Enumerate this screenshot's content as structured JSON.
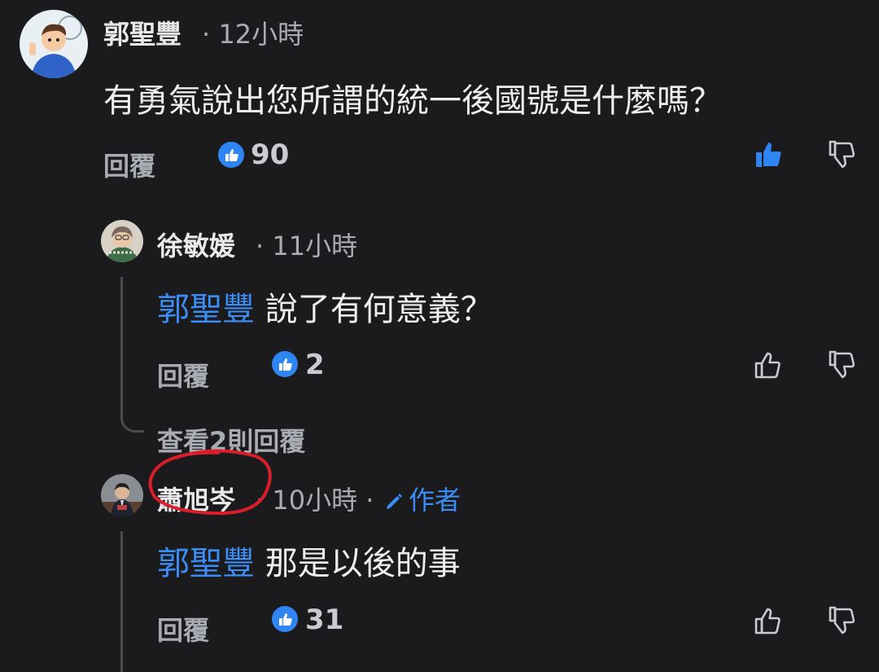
{
  "comments": [
    {
      "author": "郭聖豐",
      "time": "· 12小時",
      "text": "有勇氣說出您所謂的統一後國號是什麼嗎？",
      "reply_label": "回覆",
      "likes": "90",
      "liked": true
    },
    {
      "author": "徐敏媛",
      "time": "· 11小時",
      "mention": "郭聖豐",
      "text": " 說了有何意義？",
      "reply_label": "回覆",
      "likes": "2",
      "liked": false
    },
    {
      "author": "蕭旭岑",
      "time": "· 10小時 ·",
      "author_tag": "作者",
      "mention": "郭聖豐",
      "text": " 那是以後的事",
      "reply_label": "回覆",
      "likes": "31",
      "liked": false
    }
  ],
  "view_replies": "查看2則回覆",
  "colors": {
    "background": "#1b1b1d",
    "accent": "#3b8ef5",
    "annotation": "#d81e2a"
  }
}
